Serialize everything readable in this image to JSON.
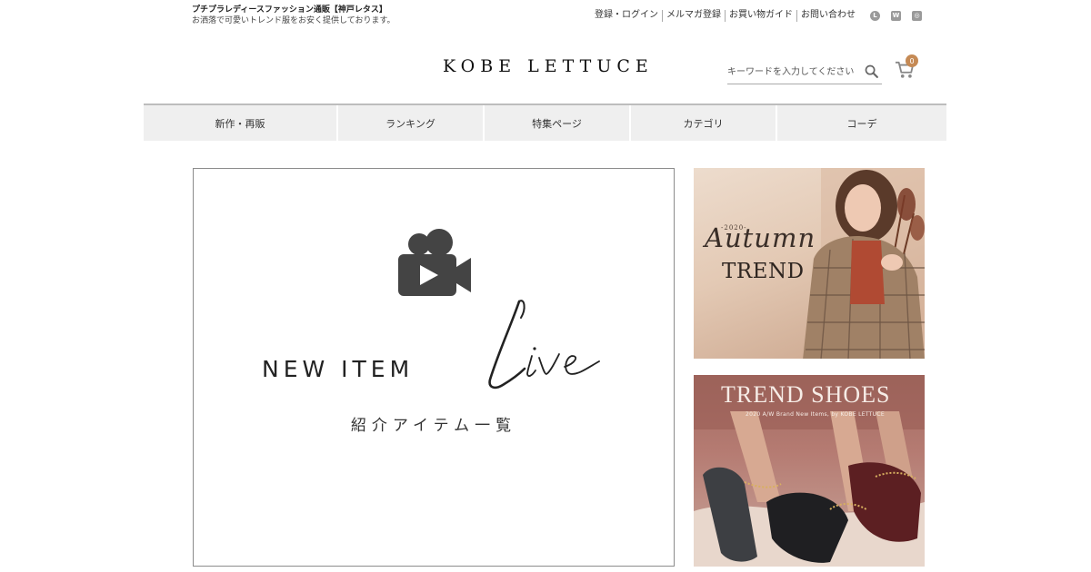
{
  "header": {
    "tagline_title": "プチプラレディースファッション通販【神戸レタス】",
    "tagline_sub": "お洒落で可愛いトレンド服をお安く提供しております。",
    "logo": "KOBE LETTUCE",
    "util_links": [
      "登録・ログイン",
      "メルマガ登録",
      "お買い物ガイド",
      "お問い合わせ"
    ],
    "social_icons": [
      "line-icon",
      "wear-icon",
      "instagram-icon"
    ],
    "social_glyphs": [
      "L",
      "W",
      "◎"
    ],
    "search_placeholder": "キーワードを入力してください",
    "cart_count": "0"
  },
  "nav": {
    "items": [
      "新作・再販",
      "ランキング",
      "特集ページ",
      "カテゴリ",
      "コーデ"
    ]
  },
  "main_banner": {
    "heading": "NEW ITEM",
    "script_word": "Live",
    "subheading": "紹介アイテム一覧",
    "icon": "video-camera-icon"
  },
  "side_banners": {
    "autumn": {
      "year": "-2020-",
      "script": "Autumn",
      "title": "TREND"
    },
    "shoes": {
      "title": "TREND SHOES",
      "subtitle": "2020 A/W Brand New Items, by KOBE LETTUCE"
    }
  },
  "colors": {
    "accent_badge": "#c58a55",
    "nav_bg": "#efefef",
    "icon_gray": "#555555"
  }
}
